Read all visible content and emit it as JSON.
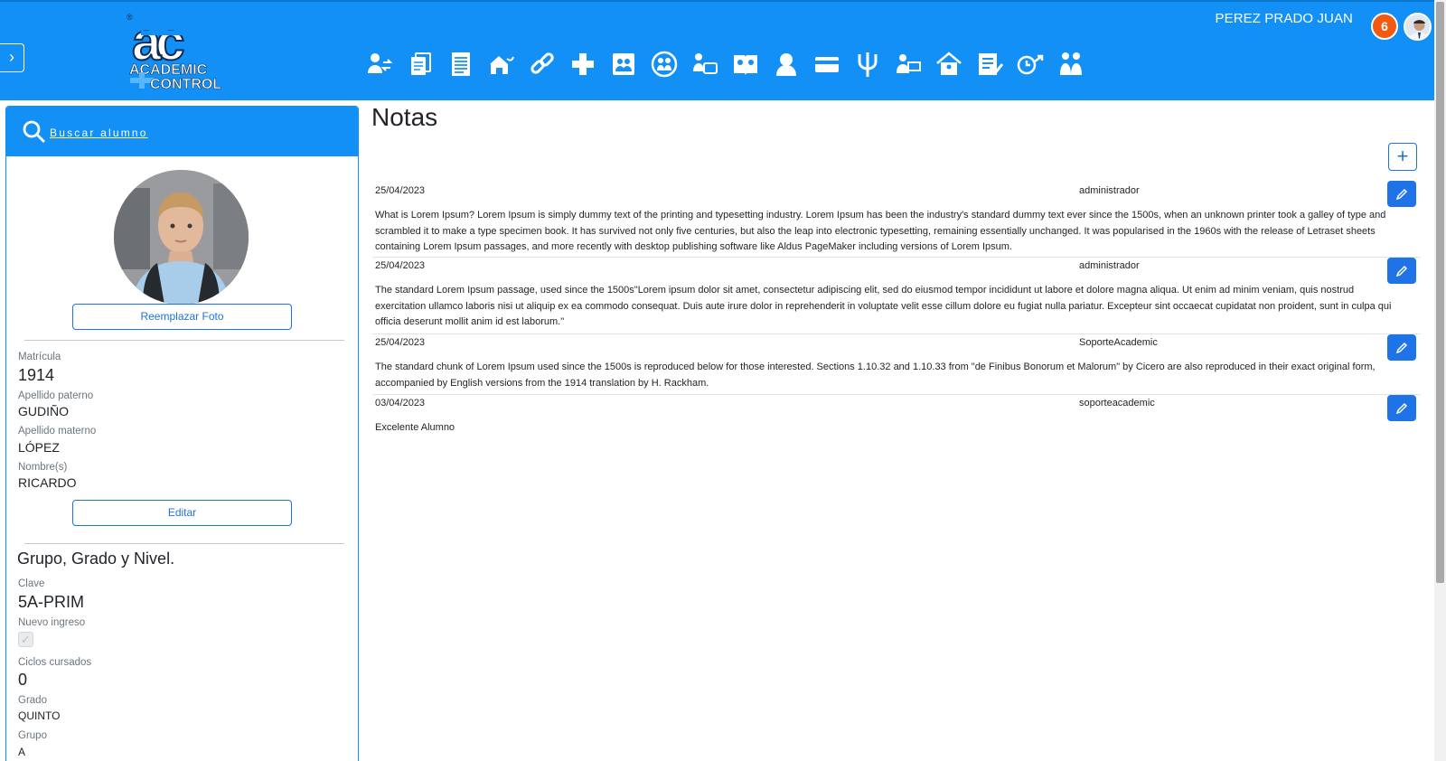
{
  "header": {
    "logo_line1": "ACADEMIC",
    "logo_line2": "CONTROL",
    "user_name": "PEREZ PRADO JUAN",
    "notification_count": "6",
    "colors": {
      "bar": "#1390f5",
      "badge": "#f25a12",
      "button": "#1e73e6"
    },
    "module_icons": [
      "students-exchange-icon",
      "documents-icon",
      "report-list-icon",
      "home-path-icon",
      "link-icon",
      "medical-cross-icon",
      "contacts-book-icon",
      "group-circle-icon",
      "student-id-icon",
      "family-book-icon",
      "counselor-icon",
      "payment-card-icon",
      "psychology-icon",
      "teacher-icon",
      "school-building-icon",
      "checklist-icon",
      "schedule-clock-icon",
      "parents-icon"
    ]
  },
  "sidebar": {
    "search_label": "Buscar alumno",
    "replace_photo_label": "Reemplazar Foto",
    "edit_label": "Editar",
    "fields": {
      "matricula_label": "Matrícula",
      "matricula_value": "1914",
      "apellido_paterno_label": "Apellido paterno",
      "apellido_paterno_value": "GUDIÑO",
      "apellido_materno_label": "Apellido materno",
      "apellido_materno_value": "LÓPEZ",
      "nombre_label": "Nombre(s)",
      "nombre_value": "RICARDO"
    },
    "group_section": {
      "title": "Grupo, Grado y Nivel.",
      "clave_label": "Clave",
      "clave_value": "5A-PRIM",
      "nuevo_ingreso_label": "Nuevo ingreso",
      "nuevo_ingreso_checked": true,
      "ciclos_label": "Ciclos cursados",
      "ciclos_value": "0",
      "grado_label": "Grado",
      "grado_value": "QUINTO",
      "grupo_label": "Grupo",
      "grupo_value": "A"
    }
  },
  "main": {
    "title": "Notas",
    "notes": [
      {
        "date": "25/04/2023",
        "author": "administrador",
        "text": "What is Lorem Ipsum? Lorem Ipsum is simply dummy text of the printing and typesetting industry. Lorem Ipsum has been the industry's standard dummy text ever since the 1500s, when an unknown printer took a galley of type and scrambled it to make a type specimen book. It has survived not only five centuries, but also the leap into electronic typesetting, remaining essentially unchanged. It was popularised in the 1960s with the release of Letraset sheets containing Lorem Ipsum passages, and more recently with desktop publishing software like Aldus PageMaker including versions of Lorem Ipsum."
      },
      {
        "date": "25/04/2023",
        "author": "administrador",
        "text": "The standard Lorem Ipsum passage, used since the 1500s\"Lorem ipsum dolor sit amet, consectetur adipiscing elit, sed do eiusmod tempor incididunt ut labore et dolore magna aliqua. Ut enim ad minim veniam, quis nostrud exercitation ullamco laboris nisi ut aliquip ex ea commodo consequat. Duis aute irure dolor in reprehenderit in voluptate velit esse cillum dolore eu fugiat nulla pariatur. Excepteur sint occaecat cupidatat non proident, sunt in culpa qui officia deserunt mollit anim id est laborum.\""
      },
      {
        "date": "25/04/2023",
        "author": "SoporteAcademic",
        "text": "The standard chunk of Lorem Ipsum used since the 1500s is reproduced below for those interested. Sections 1.10.32 and 1.10.33 from \"de Finibus Bonorum et Malorum\" by Cicero are also reproduced in their exact original form, accompanied by English versions from the 1914 translation by H. Rackham."
      },
      {
        "date": "03/04/2023",
        "author": "soporteacademic",
        "text": "Excelente Alumno"
      }
    ]
  }
}
